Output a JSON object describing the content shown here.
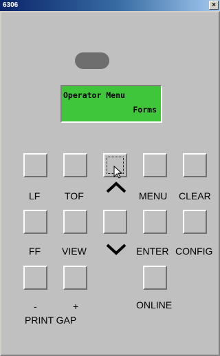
{
  "window": {
    "title": "6306",
    "close_label": "×"
  },
  "display": {
    "line1": "Operator Menu",
    "line2": "Forms"
  },
  "keys": {
    "lf": "LF",
    "tof": "TOF",
    "menu": "MENU",
    "clear": "CLEAR",
    "ff": "FF",
    "view": "VIEW",
    "enter": "ENTER",
    "config": "CONFIG",
    "print_minus": "-",
    "gap_plus": "+",
    "print_gap": "PRINT GAP",
    "online": "ONLINE"
  },
  "icons": {
    "up": "chevron-up-icon",
    "down": "chevron-down-icon",
    "led": "status-led",
    "cursor": "mouse-pointer-icon"
  },
  "colors": {
    "lcd": "#3fc63a",
    "led": "#6e6e6e",
    "titlebar": "#0a246a"
  }
}
